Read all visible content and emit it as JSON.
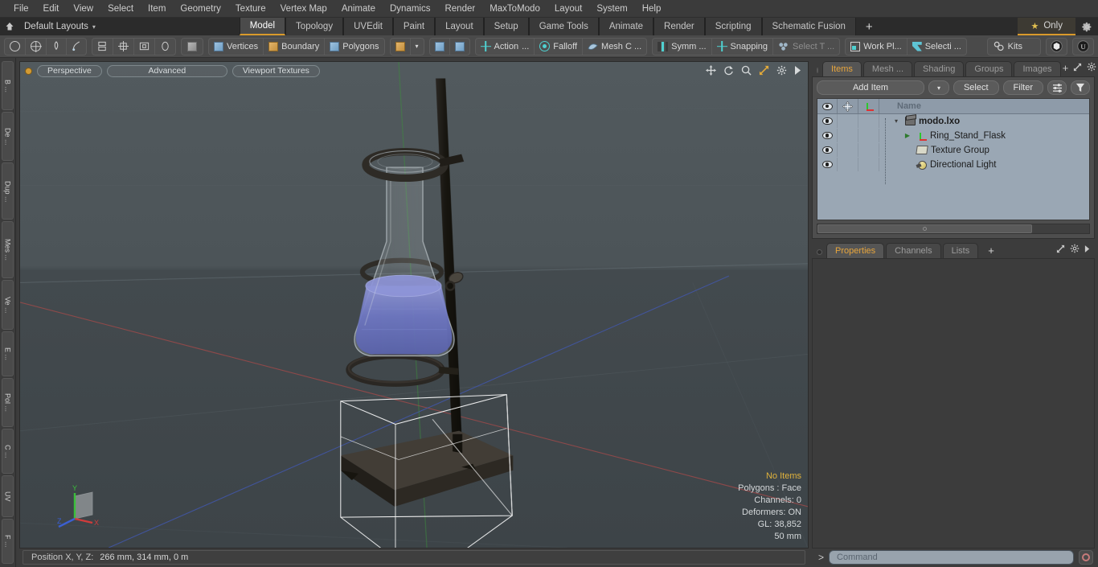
{
  "menu": {
    "items": [
      "File",
      "Edit",
      "View",
      "Select",
      "Item",
      "Geometry",
      "Texture",
      "Vertex Map",
      "Animate",
      "Dynamics",
      "Render",
      "MaxToModo",
      "Layout",
      "System",
      "Help"
    ]
  },
  "layout_row": {
    "home_icon": "home-icon",
    "layout_name": "Default Layouts",
    "caret": "▾",
    "tabs": [
      {
        "label": "Model",
        "active": true
      },
      {
        "label": "Topology",
        "active": false
      },
      {
        "label": "UVEdit",
        "active": false
      },
      {
        "label": "Paint",
        "active": false
      },
      {
        "label": "Layout",
        "active": false
      },
      {
        "label": "Setup",
        "active": false
      },
      {
        "label": "Game Tools",
        "active": false
      },
      {
        "label": "Animate",
        "active": false
      },
      {
        "label": "Render",
        "active": false
      },
      {
        "label": "Scripting",
        "active": false
      },
      {
        "label": "Schematic Fusion",
        "active": false
      }
    ],
    "add_tab": "+",
    "only_star": "★",
    "only_label": "Only",
    "gear_icon": "gear-icon",
    "accent_color": "#d99a2b"
  },
  "toolbar": {
    "shape_tools": [
      "circle-icon",
      "globe-icon",
      "pen-icon",
      "curve-icon"
    ],
    "dup_tools": [
      "mirror-icon",
      "array-icon",
      "rect-icon",
      "ellipse-icon"
    ],
    "solid_icon": "solid-cube-icon",
    "selection_modes": [
      {
        "label": "Vertices",
        "icon": "vertices-icon"
      },
      {
        "label": "Boundary",
        "icon": "boundary-icon"
      },
      {
        "label": "Polygons",
        "icon": "polygons-icon"
      }
    ],
    "item_mode_icon": "item-cube-icon",
    "item_mode_caret": "▾",
    "paint_icons": [
      "paint-cube-icon",
      "paint-cube-2-icon"
    ],
    "action_center": {
      "label": "Action",
      "ellipsis": "...",
      "icon": "action-center-icon"
    },
    "falloff": {
      "label": "Falloff",
      "icon": "falloff-icon"
    },
    "mesh_constraint": {
      "label": "Mesh C ...",
      "icon": "mesh-constraint-icon"
    },
    "symmetry": {
      "label": "Symm ...",
      "icon": "symmetry-icon"
    },
    "snapping": {
      "label": "Snapping",
      "icon": "snapping-icon"
    },
    "select_through": {
      "label": "Select T ...",
      "icon": "select-through-icon",
      "dim": true
    },
    "work_plane": {
      "label": "Work Pl...",
      "icon": "work-plane-icon"
    },
    "selection_set": {
      "label": "Selecti ...",
      "icon": "selection-icon"
    },
    "kits": {
      "label": "Kits",
      "icon": "kits-gear-icon"
    },
    "right_icons": [
      "unity-cube-icon",
      "unreal-icon"
    ]
  },
  "vtabs": [
    "B ...",
    "De ...",
    "Dup ...",
    "Mes ...",
    "Ve ...",
    "E ...",
    "Pol ...",
    "C ...",
    "UV",
    "F ..."
  ],
  "viewport": {
    "dot": "active-dot",
    "pills": [
      "Perspective",
      "Advanced",
      "Viewport Textures"
    ],
    "tools": [
      "pan-icon",
      "rotate-icon",
      "zoom-icon",
      "maximize-icon",
      "gear-icon",
      "arrow-right-icon"
    ],
    "stats": {
      "selection": "No Items",
      "polygons": "Polygons : Face",
      "channels": "Channels: 0",
      "deformers": "Deformers: ON",
      "gl": "GL: 38,852",
      "scale": "50 mm"
    },
    "gizmo": {
      "x": "X",
      "y": "Y",
      "z": "Z",
      "x_color": "#d03b3b",
      "y_color": "#3bbf3b",
      "z_color": "#3b5fd0"
    },
    "bg_color": "#4b5256",
    "scene": {
      "model": "Erlenmeyer flask on ring stand",
      "liquid_color": "#6b74c4",
      "stand_color": "#232323",
      "grid_color": "#6e7a80"
    }
  },
  "statusbar": {
    "label": "Position X, Y, Z:",
    "value": "266 mm, 314 mm, 0 m"
  },
  "right_panel": {
    "tabs": [
      {
        "label": "Items",
        "active": true
      },
      {
        "label": "Mesh ...",
        "active": false
      },
      {
        "label": "Shading",
        "active": false
      },
      {
        "label": "Groups",
        "active": false
      },
      {
        "label": "Images",
        "active": false
      }
    ],
    "tabs_add": "+",
    "tab_tools": [
      "expand-icon",
      "gear-icon",
      "arrow-right-icon"
    ],
    "add_item_label": "Add Item",
    "add_item_caret": "▾",
    "select_label": "Select",
    "filter_label": "Filter",
    "list_icon": "list-options-icon",
    "funnel_icon": "funnel-icon",
    "tree": {
      "columns": [
        "eye-column",
        "move-column",
        "axis-column",
        "Name"
      ],
      "rows": [
        {
          "label": "modo.lxo",
          "icon": "scene-film-icon",
          "indent": 0,
          "bold": true,
          "twist": "▾"
        },
        {
          "label": "Ring_Stand_Flask",
          "icon": "mesh-axis-icon",
          "indent": 1,
          "bold": false,
          "twist": "▶"
        },
        {
          "label": "Texture Group",
          "icon": "folder-icon",
          "indent": 1,
          "bold": false,
          "twist": ""
        },
        {
          "label": "Directional Light",
          "icon": "light-icon",
          "indent": 1,
          "bold": false,
          "twist": ""
        }
      ]
    }
  },
  "properties_panel": {
    "tabs": [
      {
        "label": "Properties",
        "active": true
      },
      {
        "label": "Channels",
        "active": false
      },
      {
        "label": "Lists",
        "active": false
      }
    ],
    "tabs_add": "+",
    "tools": [
      "expand-icon",
      "gear-icon",
      "arrow-right-icon"
    ]
  },
  "command_bar": {
    "prompt": ">",
    "placeholder": "Command",
    "record_icon": "record-icon"
  }
}
